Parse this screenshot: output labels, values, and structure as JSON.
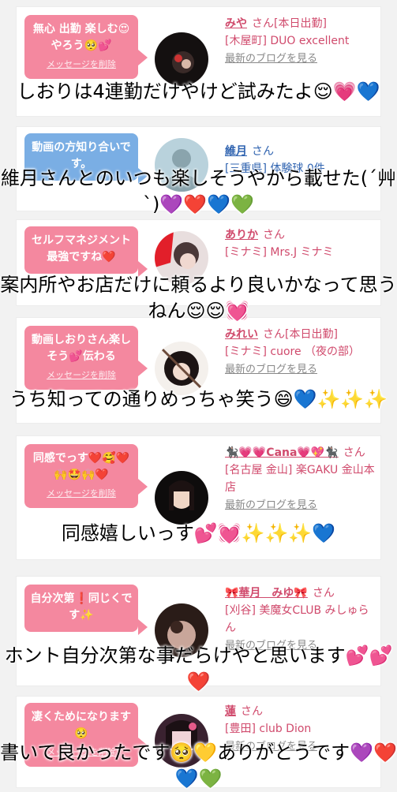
{
  "colors": {
    "bubble_pink": "#f4889f",
    "bubble_blue": "#7aaee4",
    "name_pink": "#d04a6c",
    "name_blue": "#2f63b0",
    "overlay_text": "#000000"
  },
  "cards": [
    {
      "bubble": "無心 出勤 楽しむ😍やろう🥺💕",
      "bubble_color": "pink",
      "delete_label": "メッセージを削除",
      "name": "みや",
      "san": "さん[本日出勤]",
      "shop": "[木屋町] DUO excellent",
      "blog": "最新のブログを見る",
      "overlay": "しおりは4連勤だけやけど試みたよ😌💗💙"
    },
    {
      "bubble": "動画の方知り合いです。",
      "bubble_color": "blue",
      "delete_label": "",
      "name": "維月",
      "san": "さん",
      "shop": "[三重県] 体験球 0件",
      "blog": "",
      "overlay": "維月さんとのいつも楽しそうやから載せた(´艸`)💜❤️💙💚"
    },
    {
      "bubble": "セルフマネジメント最強ですね❤️",
      "bubble_color": "pink",
      "delete_label": "",
      "name": "ありか",
      "san": "さん",
      "shop": "[ミナミ] Mrs.J ミナミ",
      "blog": "",
      "overlay": "案内所やお店だけに頼るより良いかなって思うねん😌😌💓"
    },
    {
      "bubble": "動画しおりさん楽しそう💕伝わる",
      "bubble_color": "pink",
      "delete_label": "メッセージを削除",
      "name": "みれい",
      "san": "さん[本日出勤]",
      "shop": "[ミナミ] cuore （夜の部）",
      "blog": "最新のブログを見る",
      "overlay": "うち知っての通りめっちゃ笑う😄💙✨✨✨"
    },
    {
      "bubble": "同感でっす❤️🥰❤️🙌🤩🙌❤️",
      "bubble_color": "pink",
      "delete_label": "メッセージを削除",
      "name": "🐈‍⬛💗💗Cana💗💖🐈‍⬛",
      "san": "さん",
      "shop": "[名古屋 金山] 楽GAKU 金山本店",
      "blog": "最新のブログを見る",
      "overlay": "同感嬉しいっす💕💓✨✨✨💙"
    },
    {
      "bubble": "自分次第❗️同じくです✨",
      "bubble_color": "pink",
      "delete_label": "",
      "name": "🎀華月　みゆ🎀",
      "san": "さん",
      "shop": "[刈谷] 美魔女CLUB みしゅらん",
      "blog": "最新のブログを見る",
      "overlay": "ホント自分次第な事だらけやと思います💕💕❤️"
    },
    {
      "bubble": "凄くためになります🥺",
      "bubble_color": "pink",
      "delete_label": "メッセージを削除",
      "name": "蓮",
      "san": "さん",
      "shop": "[豊田] club Dion",
      "blog": "最新のブログを見る",
      "overlay": "書いて良かったです🥺💛ありがとうです💜❤️💙💚"
    }
  ]
}
